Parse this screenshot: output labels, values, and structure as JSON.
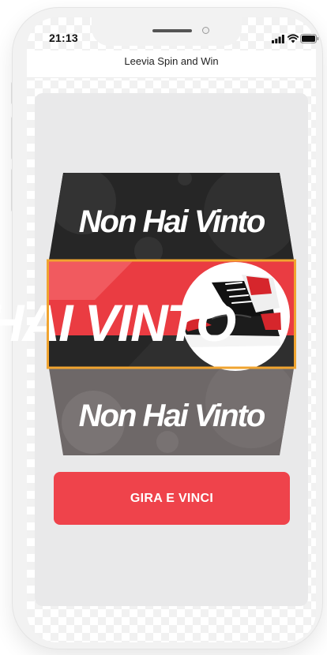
{
  "status": {
    "time": "21:13"
  },
  "header": {
    "title": "Leevia Spin and Win"
  },
  "reel": {
    "top_label": "Non Hai Vinto",
    "center_label": "HAI VINTO",
    "bottom_label": "Non Hai Vinto"
  },
  "spin_button": {
    "label": "GIRA E VINCI"
  },
  "colors": {
    "accent": "#ef434b",
    "highlight_border": "#f0a430",
    "reel_dark": "#262626",
    "reel_gray": "#6e6868"
  }
}
